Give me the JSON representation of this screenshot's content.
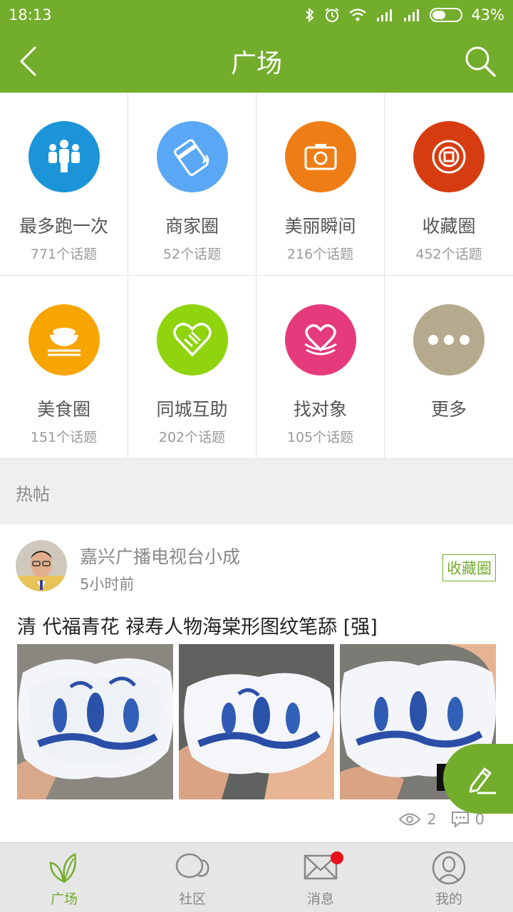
{
  "status_bar": {
    "time": "18:13",
    "battery": "43%",
    "battery_level": 0.43
  },
  "header": {
    "title": "广场"
  },
  "categories": [
    {
      "name": "最多跑一次",
      "count": "771个话题",
      "color": "#1b94d8",
      "icon": "people-icon"
    },
    {
      "name": "商家圈",
      "count": "52个话题",
      "color": "#5aa8f5",
      "icon": "card-icon"
    },
    {
      "name": "美丽瞬间",
      "count": "216个话题",
      "color": "#ef7d16",
      "icon": "camera-icon"
    },
    {
      "name": "收藏圈",
      "count": "452个话题",
      "color": "#d63c10",
      "icon": "coin-icon"
    },
    {
      "name": "美食圈",
      "count": "151个话题",
      "color": "#f7a500",
      "icon": "rice-bowl-icon"
    },
    {
      "name": "同城互助",
      "count": "202个话题",
      "color": "#8fd40c",
      "icon": "handshake-heart-icon"
    },
    {
      "name": "找对象",
      "count": "105个话题",
      "color": "#e53a7c",
      "icon": "heart-hands-icon"
    },
    {
      "name": "更多",
      "count": "",
      "color": "#b5a98e",
      "icon": "more-dots-icon"
    }
  ],
  "hot_section": {
    "label": "热帖"
  },
  "post": {
    "author": "嘉兴广播电视台小成",
    "time": "5小时前",
    "tag": "收藏圈",
    "title": "清 代福青花 禄寿人物海棠形图纹笔舔 [强]",
    "views": "2",
    "comments": "0"
  },
  "tabs": [
    {
      "label": "广场",
      "icon": "leaf-icon",
      "active": true
    },
    {
      "label": "社区",
      "icon": "chat-bubbles-icon",
      "active": false
    },
    {
      "label": "消息",
      "icon": "envelope-icon",
      "active": false,
      "badge": true
    },
    {
      "label": "我的",
      "icon": "profile-icon",
      "active": false
    }
  ],
  "colors": {
    "brand": "#73ad2c",
    "badge": "#e8101a"
  }
}
